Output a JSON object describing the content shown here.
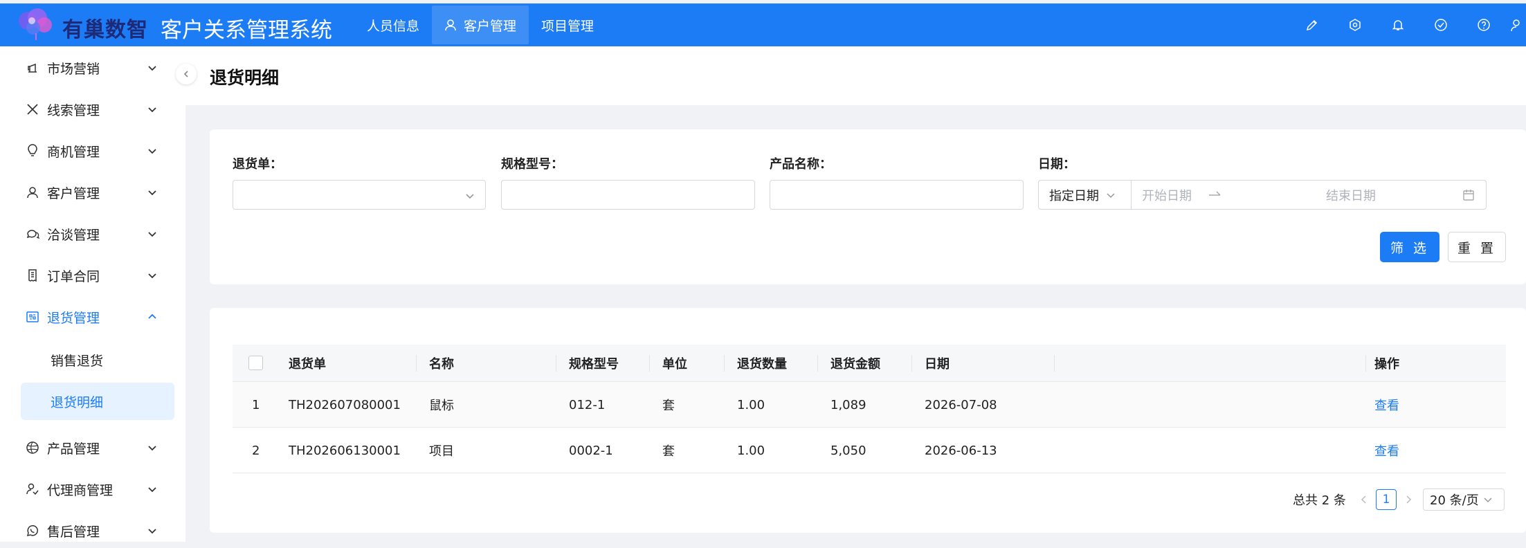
{
  "header": {
    "brand": "有巢数智",
    "system_title": "客户关系管理系统",
    "nav": [
      {
        "label": "人员信息",
        "active": false
      },
      {
        "label": "客户管理",
        "active": true
      },
      {
        "label": "项目管理",
        "active": false
      }
    ],
    "icons": [
      "brush-icon",
      "settings-icon",
      "bell-icon",
      "check-circle-icon",
      "help-icon"
    ],
    "colors": {
      "primary": "#1c7cf5",
      "brand_text": "#1e2a78"
    }
  },
  "sidebar": {
    "items": [
      {
        "label": "市场营销",
        "icon": "megaphone-icon"
      },
      {
        "label": "线索管理",
        "icon": "x-icon"
      },
      {
        "label": "商机管理",
        "icon": "lightbulb-icon"
      },
      {
        "label": "客户管理",
        "icon": "user-icon"
      },
      {
        "label": "洽谈管理",
        "icon": "chat-icon"
      },
      {
        "label": "订单合同",
        "icon": "receipt-icon"
      },
      {
        "label": "退货管理",
        "icon": "return-icon",
        "open": true
      },
      {
        "label": "产品管理",
        "icon": "ball-icon"
      },
      {
        "label": "代理商管理",
        "icon": "agent-icon"
      },
      {
        "label": "售后管理",
        "icon": "whatsapp-icon"
      }
    ],
    "sub_items": [
      {
        "label": "销售退货",
        "active": false
      },
      {
        "label": "退货明细",
        "active": true
      }
    ]
  },
  "page": {
    "title": "退货明细"
  },
  "filters": {
    "return_no_label": "退货单：",
    "spec_label": "规格型号：",
    "product_label": "产品名称：",
    "date_label": "日期：",
    "date_mode": "指定日期",
    "start_placeholder": "开始日期",
    "end_placeholder": "结束日期",
    "filter_button": "筛 选",
    "reset_button": "重 置"
  },
  "table": {
    "columns": [
      "退货单",
      "名称",
      "规格型号",
      "单位",
      "退货数量",
      "退货金额",
      "日期",
      "操作"
    ],
    "rows": [
      {
        "index": "1",
        "return_no": "TH202607080001",
        "name": "鼠标",
        "spec": "012-1",
        "unit": "套",
        "qty": "1.00",
        "amount": "1,089",
        "date": "2026-07-08",
        "action": "查看"
      },
      {
        "index": "2",
        "return_no": "TH202606130001",
        "name": "项目",
        "spec": "0002-1",
        "unit": "套",
        "qty": "1.00",
        "amount": "5,050",
        "date": "2026-06-13",
        "action": "查看"
      }
    ]
  },
  "pagination": {
    "total": "总共 2 条",
    "current_page": "1",
    "page_size": "20 条/页"
  }
}
